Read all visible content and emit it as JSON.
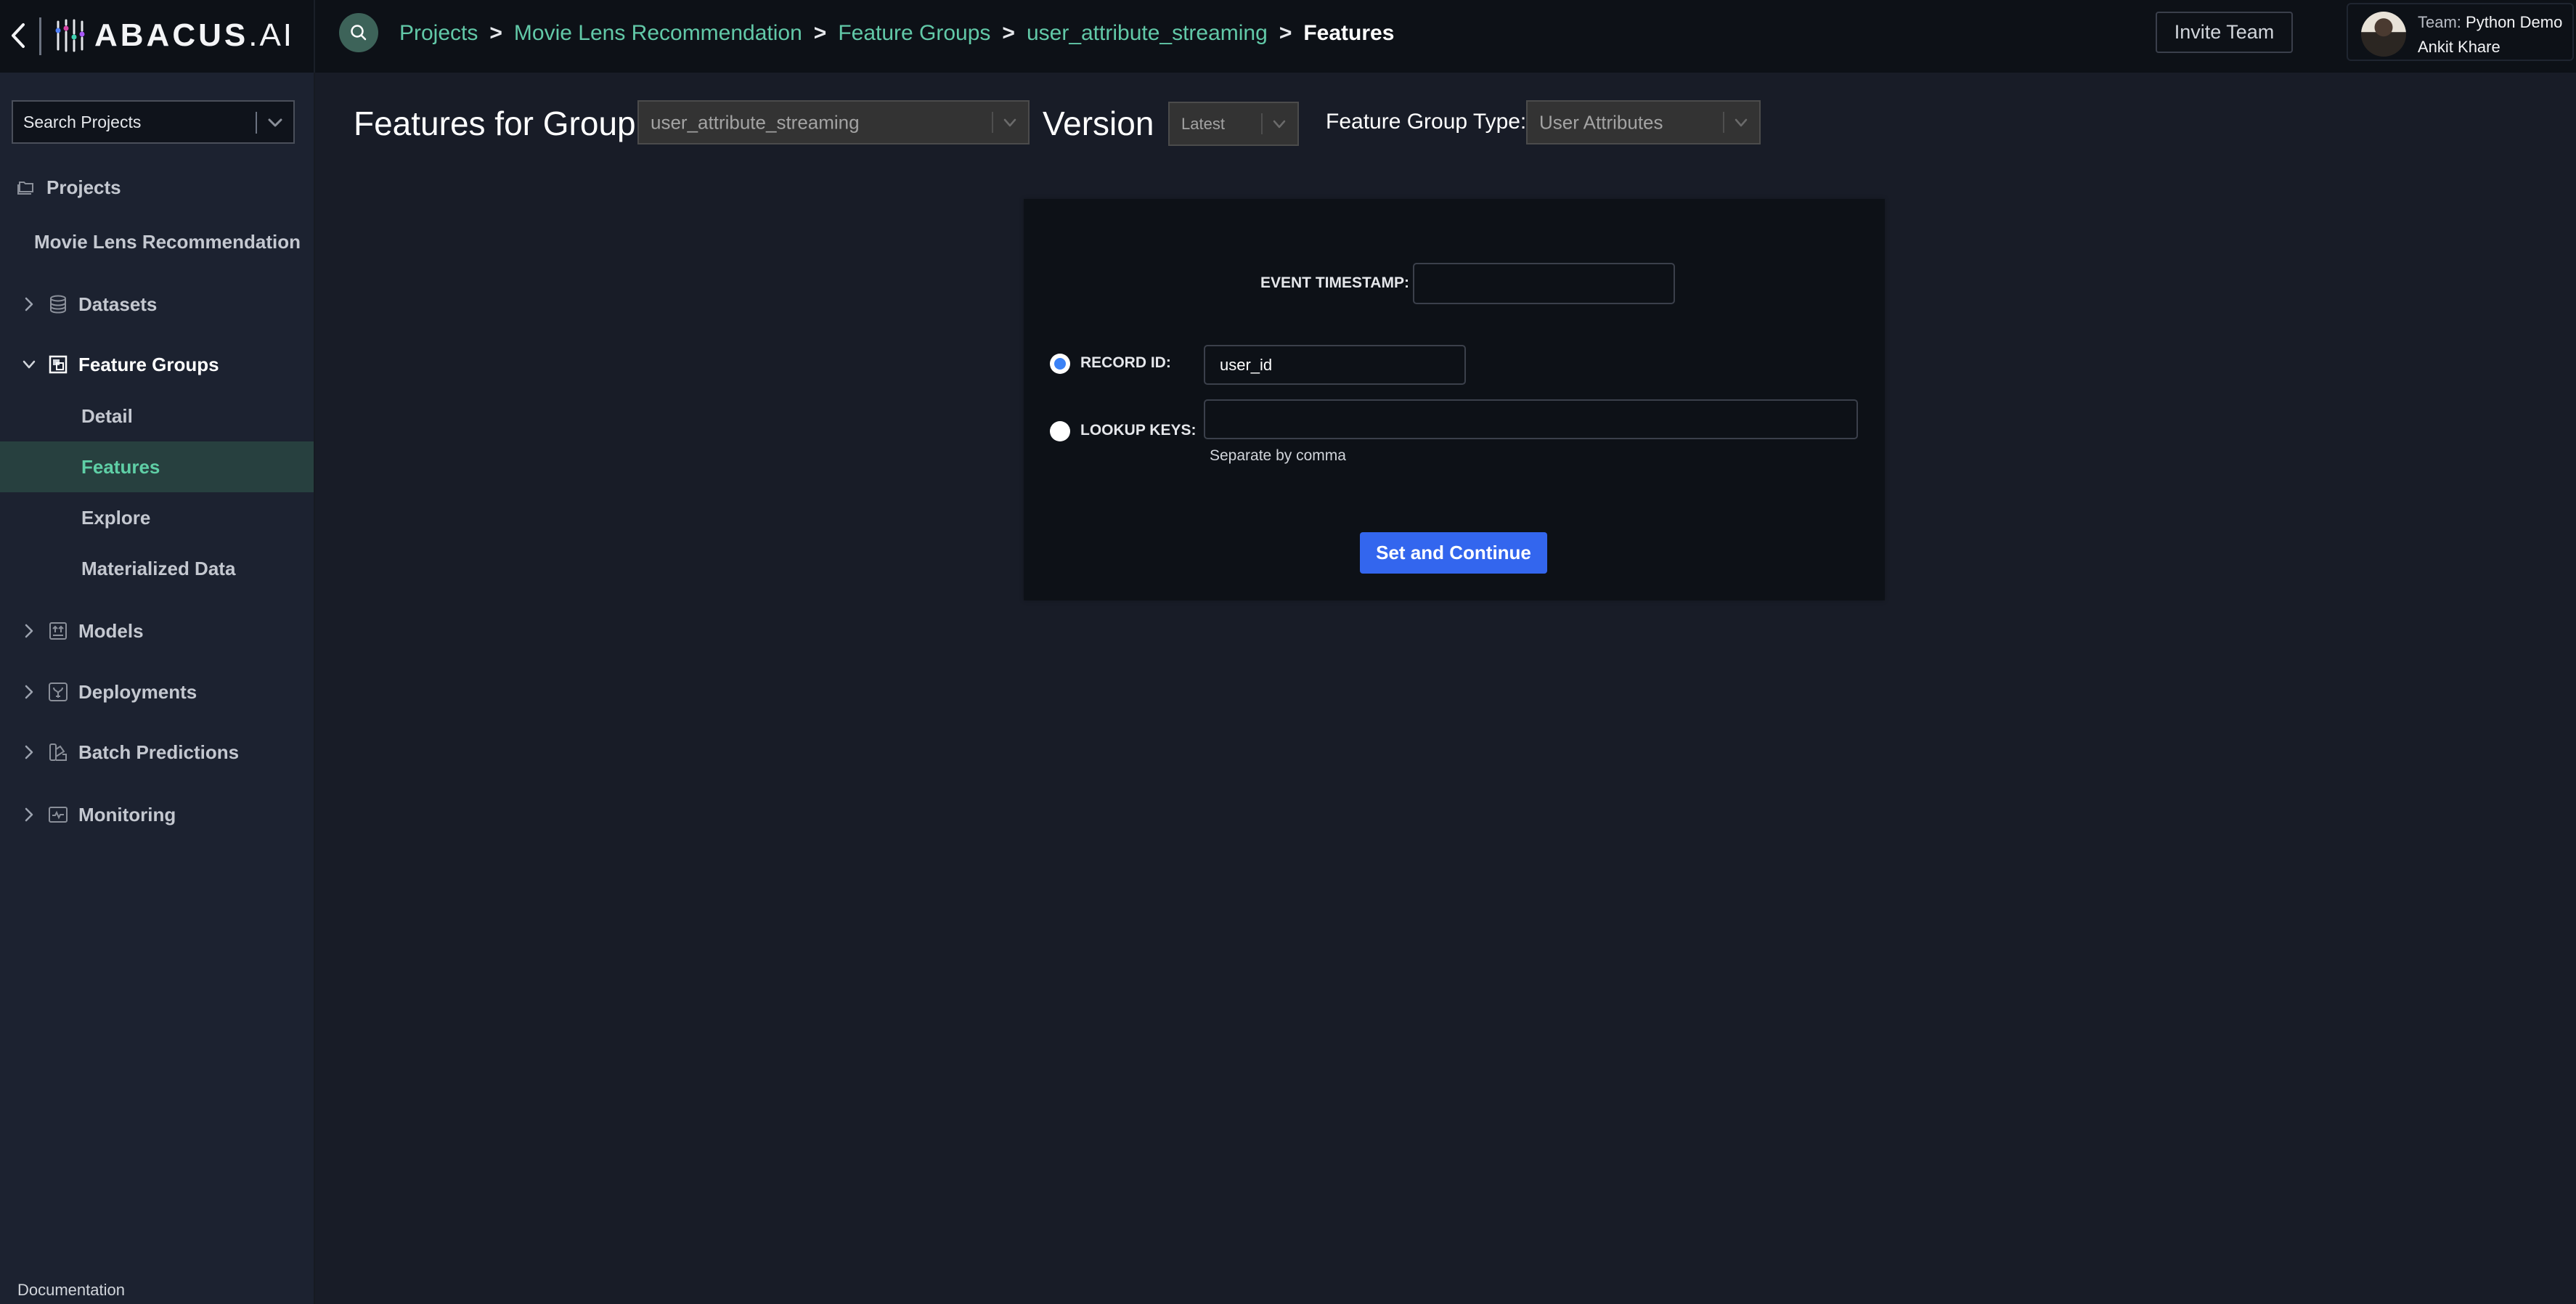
{
  "app": {
    "logo_text": "ABACUS",
    "logo_suffix": ".AI"
  },
  "breadcrumb": [
    {
      "label": "Projects"
    },
    {
      "label": "Movie Lens Recommendation"
    },
    {
      "label": "Feature Groups"
    },
    {
      "label": "user_attribute_streaming"
    },
    {
      "label": "Features"
    }
  ],
  "breadcrumb_separator": ">",
  "header": {
    "invite_label": "Invite Team",
    "user": {
      "team_label": "Team:",
      "team_name": "Python Demo",
      "name": "Ankit Khare"
    }
  },
  "sidebar": {
    "search_placeholder": "Search Projects",
    "projects_label": "Projects",
    "project_name": "Movie Lens Recommendation",
    "items": [
      {
        "label": "Datasets",
        "icon": "database-icon",
        "expanded": false
      },
      {
        "label": "Feature Groups",
        "icon": "feature-groups-icon",
        "expanded": true,
        "children": [
          {
            "label": "Detail"
          },
          {
            "label": "Features",
            "active": true
          },
          {
            "label": "Explore"
          },
          {
            "label": "Materialized Data"
          }
        ]
      },
      {
        "label": "Models",
        "icon": "models-icon",
        "expanded": false
      },
      {
        "label": "Deployments",
        "icon": "deployments-icon",
        "expanded": false
      },
      {
        "label": "Batch Predictions",
        "icon": "batch-predictions-icon",
        "expanded": false
      },
      {
        "label": "Monitoring",
        "icon": "monitoring-icon",
        "expanded": false
      }
    ],
    "documentation_label": "Documentation"
  },
  "main": {
    "title": "Features for Group:",
    "group_select": {
      "value": "user_attribute_streaming"
    },
    "version_label": "Version",
    "version_select": {
      "value": "Latest"
    },
    "type_label": "Feature Group Type:",
    "type_select": {
      "value": "User Attributes"
    }
  },
  "form": {
    "event_timestamp_label": "EVENT TIMESTAMP:",
    "event_timestamp_value": "",
    "record_id_label": "RECORD ID:",
    "record_id_value": "user_id",
    "record_id_selected": true,
    "lookup_keys_label": "LOOKUP KEYS:",
    "lookup_keys_value": "",
    "lookup_keys_selected": false,
    "lookup_keys_hint": "Separate by comma",
    "submit_label": "Set and Continue"
  },
  "colors": {
    "accent": "#62c9a8",
    "primary_button": "#3366ee",
    "active_nav_bg": "#27403f"
  }
}
